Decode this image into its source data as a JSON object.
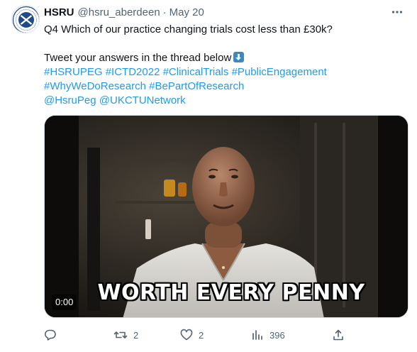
{
  "tweet": {
    "author_name": "HSRU",
    "handle": "@hsru_aberdeen",
    "separator": "·",
    "date": "May 20",
    "text_line1": "Q4  Which of our practice changing trials cost less than £30k?",
    "text_line2": "Tweet your answers in the thread below",
    "emoji": "down-arrow-emoji",
    "hashtags_line1": [
      "#HSRUPEG",
      "#ICTD2022",
      "#ClinicalTrials",
      "#PublicEngagement"
    ],
    "hashtags_line2": [
      "#WhyWeDoResearch",
      "#BePartOfResearch"
    ],
    "mentions": [
      "@HsruPeg",
      "@UKCTUNetwork"
    ]
  },
  "media": {
    "time_badge": "0:00",
    "caption": "WORTH EVERY PENNY"
  },
  "actions": {
    "reply_count": "",
    "retweet_count": "2",
    "like_count": "2",
    "views_count": "396"
  },
  "colors": {
    "link": "#1d9bf0",
    "text": "#0f1419",
    "secondary": "#536471",
    "border": "#cfd9de",
    "avatar_blue": "#1f4a8c"
  },
  "icons": [
    "more-icon",
    "reply-icon",
    "retweet-icon",
    "like-icon",
    "views-icon",
    "share-icon"
  ]
}
